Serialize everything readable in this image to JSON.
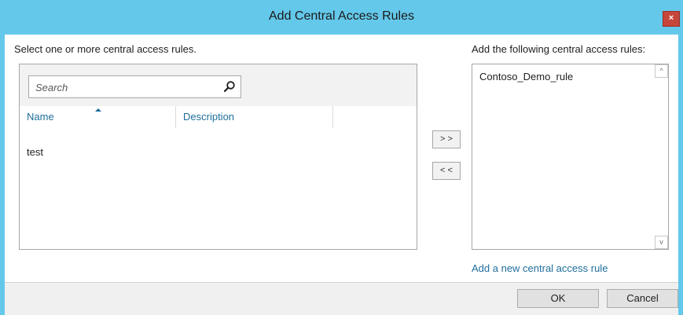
{
  "window": {
    "title": "Add Central Access Rules",
    "close_glyph": "×",
    "accent_color": "#64c8ea",
    "close_color": "#c7463b"
  },
  "left": {
    "label": "Select one or more central access rules.",
    "search_placeholder": "Search",
    "columns": [
      "Name",
      "Description"
    ],
    "rows": [
      {
        "name": "test",
        "description": ""
      }
    ]
  },
  "move_buttons": {
    "add": "> >",
    "remove": "< <"
  },
  "right": {
    "label": "Add the following central access rules:",
    "items": [
      "Contoso_Demo_rule"
    ],
    "scroll_up_glyph": "^",
    "scroll_down_glyph": "v"
  },
  "link": {
    "label": "Add a new central access rule",
    "color": "#1f6e9c"
  },
  "footer": {
    "ok_label": "OK",
    "cancel_label": "Cancel"
  },
  "icons": [
    "close-icon",
    "search-icon",
    "sort-ascending-icon",
    "scroll-up-icon",
    "scroll-down-icon"
  ]
}
